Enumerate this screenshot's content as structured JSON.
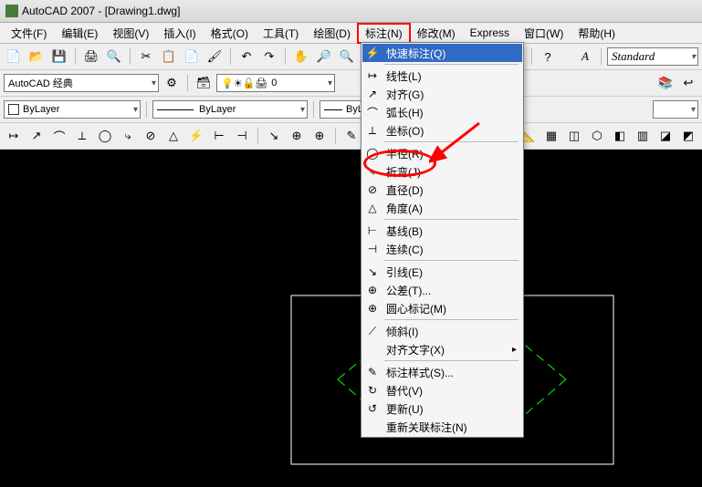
{
  "title": "AutoCAD 2007 - [Drawing1.dwg]",
  "menubar": {
    "items": [
      {
        "label": "文件(F)"
      },
      {
        "label": "编辑(E)"
      },
      {
        "label": "视图(V)"
      },
      {
        "label": "插入(I)"
      },
      {
        "label": "格式(O)"
      },
      {
        "label": "工具(T)"
      },
      {
        "label": "绘图(D)"
      },
      {
        "label": "标注(N)",
        "highlighted": true
      },
      {
        "label": "修改(M)"
      },
      {
        "label": "Express"
      },
      {
        "label": "窗口(W)"
      },
      {
        "label": "帮助(H)"
      }
    ]
  },
  "toolbars": {
    "workspace": "AutoCAD 经典",
    "layer": "ByLayer",
    "linetype": "ByLayer",
    "lineweight": "ByL",
    "zero": "0",
    "standard": "Standard"
  },
  "dropdown": {
    "groups": [
      [
        {
          "icon": "⚡",
          "label": "快速标注(Q)",
          "selected": true
        }
      ],
      [
        {
          "icon": "↦",
          "label": "线性(L)"
        },
        {
          "icon": "↗",
          "label": "对齐(G)"
        },
        {
          "icon": "⌒",
          "label": "弧长(H)"
        },
        {
          "icon": "⟂",
          "label": "坐标(O)"
        }
      ],
      [
        {
          "icon": "◯",
          "label": "半径(R)",
          "annot": "circle"
        },
        {
          "icon": "⤷",
          "label": "折弯(J)"
        },
        {
          "icon": "⊘",
          "label": "直径(D)"
        },
        {
          "icon": "△",
          "label": "角度(A)"
        }
      ],
      [
        {
          "icon": "⊢",
          "label": "基线(B)"
        },
        {
          "icon": "⊣",
          "label": "连续(C)"
        }
      ],
      [
        {
          "icon": "↘",
          "label": "引线(E)"
        },
        {
          "icon": "⊕",
          "label": "公差(T)..."
        },
        {
          "icon": "⊕",
          "label": "圆心标记(M)"
        }
      ],
      [
        {
          "icon": "⟋",
          "label": "倾斜(I)"
        },
        {
          "icon": "",
          "label": "对齐文字(X)",
          "submenu": true
        }
      ],
      [
        {
          "icon": "✎",
          "label": "标注样式(S)..."
        },
        {
          "icon": "↻",
          "label": "替代(V)"
        },
        {
          "icon": "↺",
          "label": "更新(U)"
        },
        {
          "icon": "",
          "label": "重新关联标注(N)"
        }
      ]
    ]
  }
}
